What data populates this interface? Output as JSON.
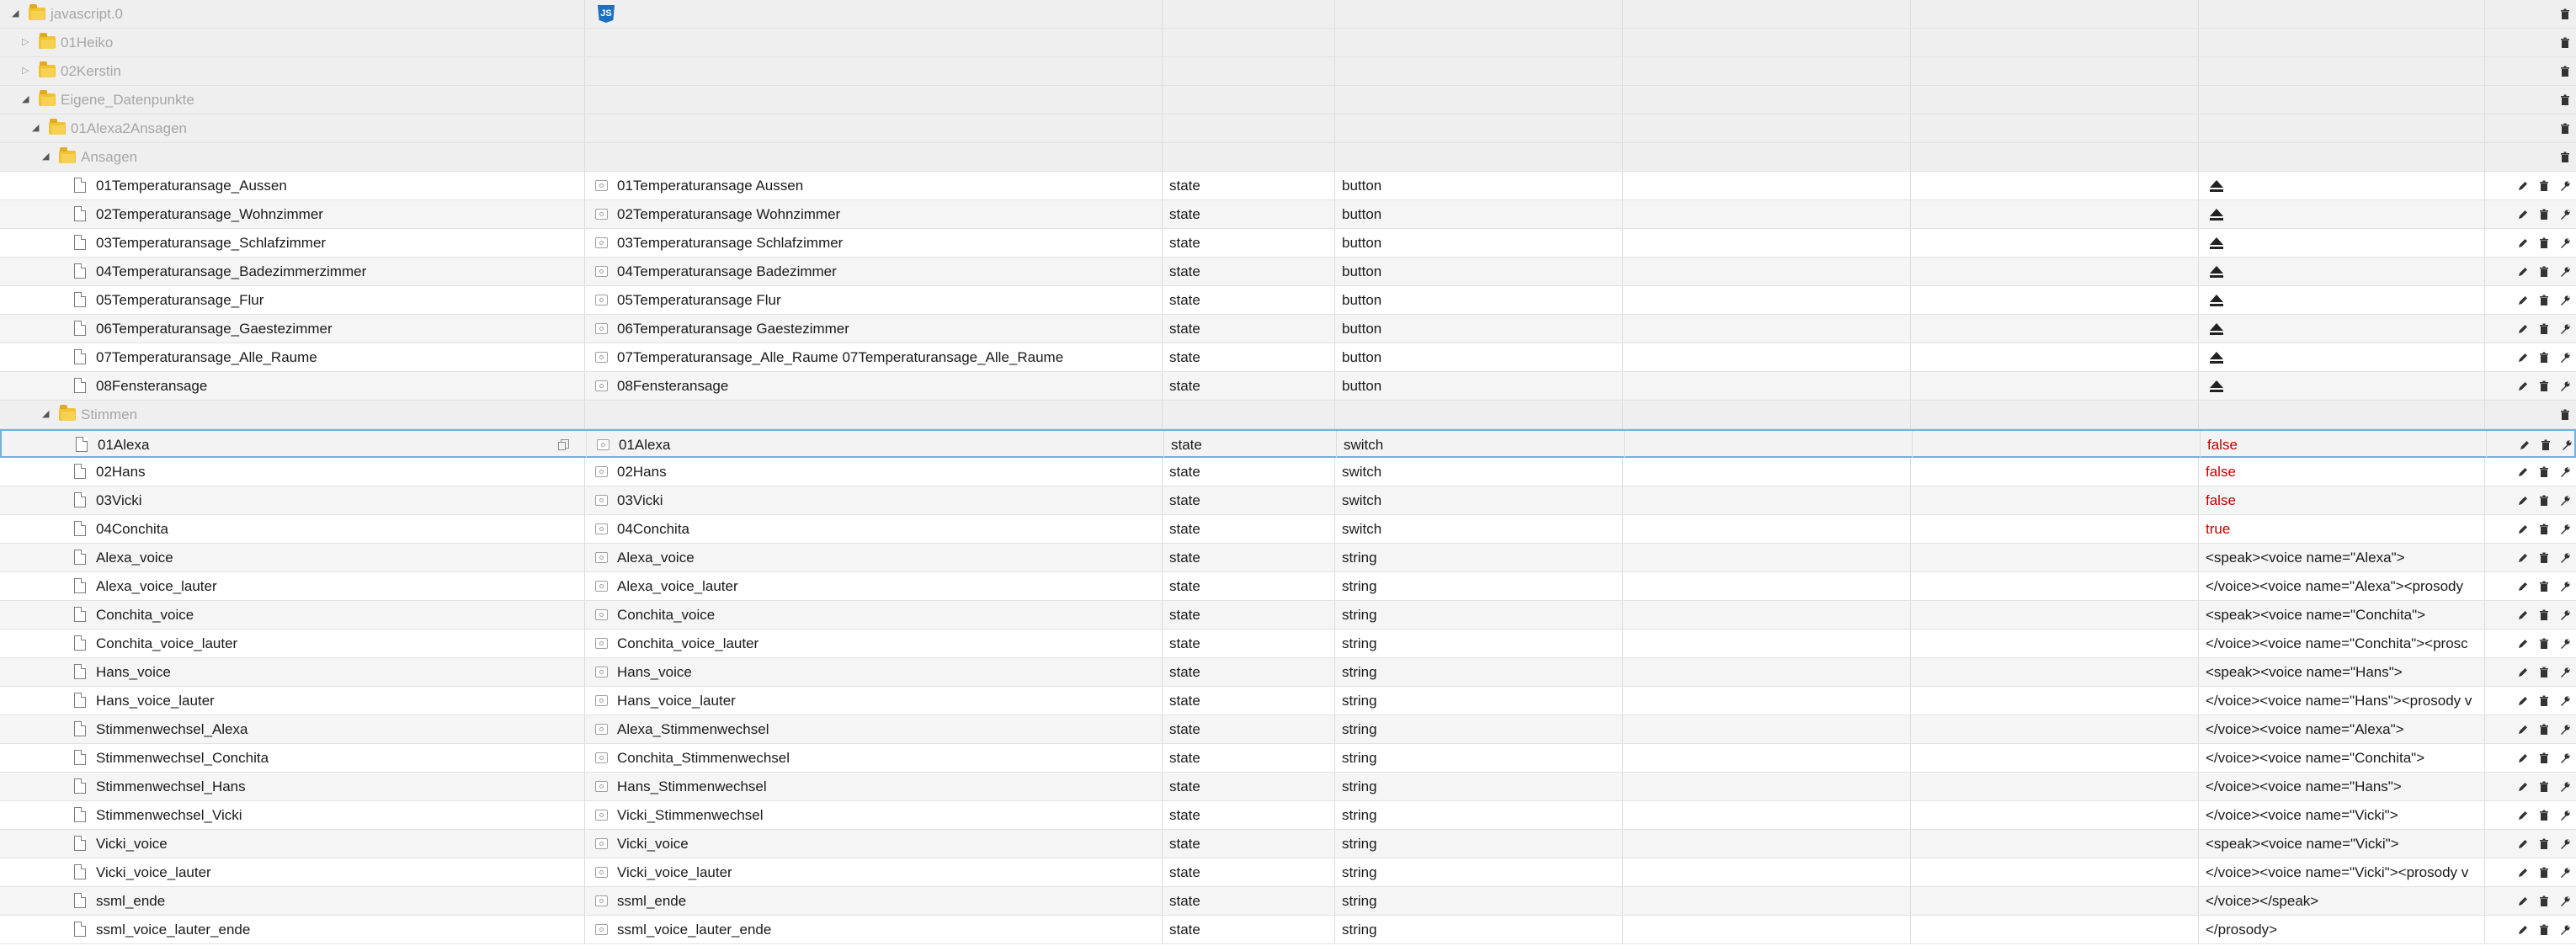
{
  "tree_rows": [
    {
      "kind": "folder",
      "depth": 0,
      "expander": "open",
      "id": "javascript.0",
      "name_icon": "js-icon",
      "name_icon_text": "JS",
      "actions": [
        "delete"
      ]
    },
    {
      "kind": "folder",
      "depth": 1,
      "expander": "closed",
      "id": "01Heiko",
      "actions": [
        "delete"
      ]
    },
    {
      "kind": "folder",
      "depth": 1,
      "expander": "closed",
      "id": "02Kerstin",
      "actions": [
        "delete"
      ]
    },
    {
      "kind": "folder",
      "depth": 1,
      "expander": "open",
      "id": "Eigene_Datenpunkte",
      "actions": [
        "delete"
      ]
    },
    {
      "kind": "folder",
      "depth": 2,
      "expander": "open",
      "id": "01Alexa2Ansagen",
      "actions": [
        "delete"
      ]
    },
    {
      "kind": "folder",
      "depth": 3,
      "expander": "open",
      "id": "Ansagen",
      "actions": [
        "delete"
      ]
    },
    {
      "kind": "state",
      "depth": 4,
      "id": "01Temperaturansage_Aussen",
      "name": "01Temperaturansage Aussen",
      "type": "state",
      "role": "button",
      "value_button": true,
      "actions": [
        "edit",
        "delete",
        "wrench"
      ]
    },
    {
      "kind": "state",
      "depth": 4,
      "id": "02Temperaturansage_Wohnzimmer",
      "name": "02Temperaturansage Wohnzimmer",
      "type": "state",
      "role": "button",
      "value_button": true,
      "actions": [
        "edit",
        "delete",
        "wrench"
      ]
    },
    {
      "kind": "state",
      "depth": 4,
      "id": "03Temperaturansage_Schlafzimmer",
      "name": "03Temperaturansage Schlafzimmer",
      "type": "state",
      "role": "button",
      "value_button": true,
      "actions": [
        "edit",
        "delete",
        "wrench"
      ]
    },
    {
      "kind": "state",
      "depth": 4,
      "id": "04Temperaturansage_Badezimmerzimmer",
      "name": "04Temperaturansage Badezimmer",
      "type": "state",
      "role": "button",
      "value_button": true,
      "actions": [
        "edit",
        "delete",
        "wrench"
      ]
    },
    {
      "kind": "state",
      "depth": 4,
      "id": "05Temperaturansage_Flur",
      "name": "05Temperaturansage Flur",
      "type": "state",
      "role": "button",
      "value_button": true,
      "actions": [
        "edit",
        "delete",
        "wrench"
      ]
    },
    {
      "kind": "state",
      "depth": 4,
      "id": "06Temperaturansage_Gaestezimmer",
      "name": "06Temperaturansage Gaestezimmer",
      "type": "state",
      "role": "button",
      "value_button": true,
      "actions": [
        "edit",
        "delete",
        "wrench"
      ]
    },
    {
      "kind": "state",
      "depth": 4,
      "id": "07Temperaturansage_Alle_Raume",
      "name": "07Temperaturansage_Alle_Raume 07Temperaturansage_Alle_Raume",
      "type": "state",
      "role": "button",
      "value_button": true,
      "actions": [
        "edit",
        "delete",
        "wrench"
      ]
    },
    {
      "kind": "state",
      "depth": 4,
      "id": "08Fensteransage",
      "name": "08Fensteransage",
      "type": "state",
      "role": "button",
      "value_button": true,
      "actions": [
        "edit",
        "delete",
        "wrench"
      ]
    },
    {
      "kind": "folder",
      "depth": 3,
      "expander": "open",
      "id": "Stimmen",
      "actions": [
        "delete"
      ]
    },
    {
      "kind": "state",
      "depth": 4,
      "id": "01Alexa",
      "name": "01Alexa",
      "type": "state",
      "role": "switch",
      "value": "false",
      "value_class": "false-val",
      "selected": true,
      "copy_icon": true,
      "actions": [
        "edit",
        "delete",
        "wrench"
      ]
    },
    {
      "kind": "state",
      "depth": 4,
      "id": "02Hans",
      "name": "02Hans",
      "type": "state",
      "role": "switch",
      "value": "false",
      "value_class": "false-val",
      "actions": [
        "edit",
        "delete",
        "wrench"
      ]
    },
    {
      "kind": "state",
      "depth": 4,
      "id": "03Vicki",
      "name": "03Vicki",
      "type": "state",
      "role": "switch",
      "value": "false",
      "value_class": "false-val",
      "actions": [
        "edit",
        "delete",
        "wrench"
      ]
    },
    {
      "kind": "state",
      "depth": 4,
      "id": "04Conchita",
      "name": "04Conchita",
      "type": "state",
      "role": "switch",
      "value": "true",
      "value_class": "true-val",
      "actions": [
        "edit",
        "delete",
        "wrench"
      ]
    },
    {
      "kind": "state",
      "depth": 4,
      "id": "Alexa_voice",
      "name": "Alexa_voice",
      "type": "state",
      "role": "string",
      "value": "<speak><voice name=\"Alexa\">",
      "actions": [
        "edit",
        "delete",
        "wrench"
      ]
    },
    {
      "kind": "state",
      "depth": 4,
      "id": "Alexa_voice_lauter",
      "name": "Alexa_voice_lauter",
      "type": "state",
      "role": "string",
      "value": "</voice><voice name=\"Alexa\"><prosody",
      "actions": [
        "edit",
        "delete",
        "wrench"
      ]
    },
    {
      "kind": "state",
      "depth": 4,
      "id": "Conchita_voice",
      "name": "Conchita_voice",
      "type": "state",
      "role": "string",
      "value": "<speak><voice name=\"Conchita\">",
      "actions": [
        "edit",
        "delete",
        "wrench"
      ]
    },
    {
      "kind": "state",
      "depth": 4,
      "id": "Conchita_voice_lauter",
      "name": "Conchita_voice_lauter",
      "type": "state",
      "role": "string",
      "value": "</voice><voice name=\"Conchita\"><prosc",
      "actions": [
        "edit",
        "delete",
        "wrench"
      ]
    },
    {
      "kind": "state",
      "depth": 4,
      "id": "Hans_voice",
      "name": "Hans_voice",
      "type": "state",
      "role": "string",
      "value": "<speak><voice name=\"Hans\">",
      "actions": [
        "edit",
        "delete",
        "wrench"
      ]
    },
    {
      "kind": "state",
      "depth": 4,
      "id": "Hans_voice_lauter",
      "name": "Hans_voice_lauter",
      "type": "state",
      "role": "string",
      "value": "</voice><voice name=\"Hans\"><prosody v",
      "actions": [
        "edit",
        "delete",
        "wrench"
      ]
    },
    {
      "kind": "state",
      "depth": 4,
      "id": "Stimmenwechsel_Alexa",
      "name": "Alexa_Stimmenwechsel",
      "type": "state",
      "role": "string",
      "value": "</voice><voice name=\"Alexa\">",
      "actions": [
        "edit",
        "delete",
        "wrench"
      ]
    },
    {
      "kind": "state",
      "depth": 4,
      "id": "Stimmenwechsel_Conchita",
      "name": "Conchita_Stimmenwechsel",
      "type": "state",
      "role": "string",
      "value": "</voice><voice name=\"Conchita\">",
      "actions": [
        "edit",
        "delete",
        "wrench"
      ]
    },
    {
      "kind": "state",
      "depth": 4,
      "id": "Stimmenwechsel_Hans",
      "name": "Hans_Stimmenwechsel",
      "type": "state",
      "role": "string",
      "value": "</voice><voice name=\"Hans\">",
      "actions": [
        "edit",
        "delete",
        "wrench"
      ]
    },
    {
      "kind": "state",
      "depth": 4,
      "id": "Stimmenwechsel_Vicki",
      "name": "Vicki_Stimmenwechsel",
      "type": "state",
      "role": "string",
      "value": "</voice><voice name=\"Vicki\">",
      "actions": [
        "edit",
        "delete",
        "wrench"
      ]
    },
    {
      "kind": "state",
      "depth": 4,
      "id": "Vicki_voice",
      "name": "Vicki_voice",
      "type": "state",
      "role": "string",
      "value": "<speak><voice name=\"Vicki\">",
      "actions": [
        "edit",
        "delete",
        "wrench"
      ]
    },
    {
      "kind": "state",
      "depth": 4,
      "id": "Vicki_voice_lauter",
      "name": "Vicki_voice_lauter",
      "type": "state",
      "role": "string",
      "value": "</voice><voice name=\"Vicki\"><prosody v",
      "actions": [
        "edit",
        "delete",
        "wrench"
      ]
    },
    {
      "kind": "state",
      "depth": 4,
      "id": "ssml_ende",
      "name": "ssml_ende",
      "type": "state",
      "role": "string",
      "value": "</voice></speak>",
      "actions": [
        "edit",
        "delete",
        "wrench"
      ]
    },
    {
      "kind": "state",
      "depth": 4,
      "id": "ssml_voice_lauter_ende",
      "name": "ssml_voice_lauter_ende",
      "type": "state",
      "role": "string",
      "value": "</prosody>",
      "actions": [
        "edit",
        "delete",
        "wrench"
      ]
    }
  ],
  "colors": {
    "selection_border": "#6cb4de",
    "folder_text": "#a6a6a6",
    "bool_value": "#c00000",
    "folder_icon": "#f2c233",
    "js_icon": "#1e6fbd"
  },
  "icons": {
    "folder": "folder-icon",
    "file": "file-icon",
    "state_name": "state-icon",
    "button_value": "eject-button-icon",
    "copy": "copy-icon",
    "edit": "pencil-icon",
    "delete": "trash-icon",
    "wrench": "wrench-icon",
    "expander_open": "expand-open-icon",
    "expander_closed": "expand-closed-icon"
  }
}
